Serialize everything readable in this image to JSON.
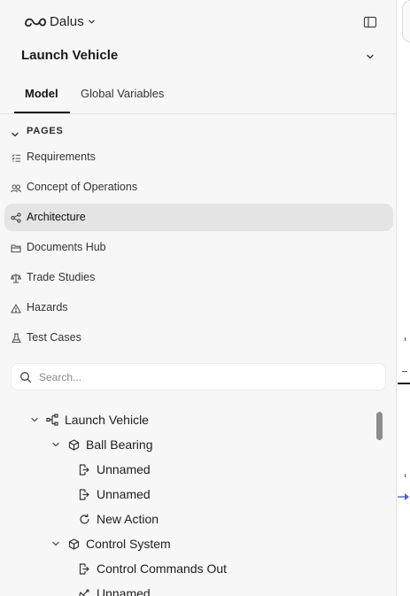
{
  "app": {
    "logo_text": "Dalus"
  },
  "project": {
    "title": "Launch Vehicle"
  },
  "tabs": [
    {
      "label": "Model",
      "active": true
    },
    {
      "label": "Global Variables",
      "active": false
    }
  ],
  "pages": {
    "header": "PAGES",
    "items": [
      {
        "label": "Requirements",
        "icon": "list-check-icon",
        "active": false
      },
      {
        "label": "Concept of Operations",
        "icon": "users-icon",
        "active": false
      },
      {
        "label": "Architecture",
        "icon": "share-nodes-icon",
        "active": true
      },
      {
        "label": "Documents Hub",
        "icon": "folder-icon",
        "active": false
      },
      {
        "label": "Trade Studies",
        "icon": "scale-icon",
        "active": false
      },
      {
        "label": "Hazards",
        "icon": "warning-icon",
        "active": false
      },
      {
        "label": "Test Cases",
        "icon": "flask-icon",
        "active": false
      }
    ]
  },
  "search": {
    "placeholder": "Search..."
  },
  "tree": [
    {
      "label": "Launch Vehicle",
      "icon": "hierarchy-icon",
      "expanded": true
    },
    {
      "label": "Ball Bearing",
      "icon": "cube-icon",
      "expanded": true
    },
    {
      "label": "Unnamed",
      "icon": "port-out-icon"
    },
    {
      "label": "Unnamed",
      "icon": "port-out-icon"
    },
    {
      "label": "New Action",
      "icon": "refresh-icon"
    },
    {
      "label": "Control System",
      "icon": "cube-icon",
      "expanded": true
    },
    {
      "label": "Control Commands Out",
      "icon": "port-out-icon"
    },
    {
      "label": "Unnamed",
      "icon": "satellite-icon"
    }
  ],
  "colors": {
    "sidebar_bg": "#f7f7f7",
    "active_item_bg": "#e4e4e4",
    "accent_arrow": "#4a63d8"
  }
}
